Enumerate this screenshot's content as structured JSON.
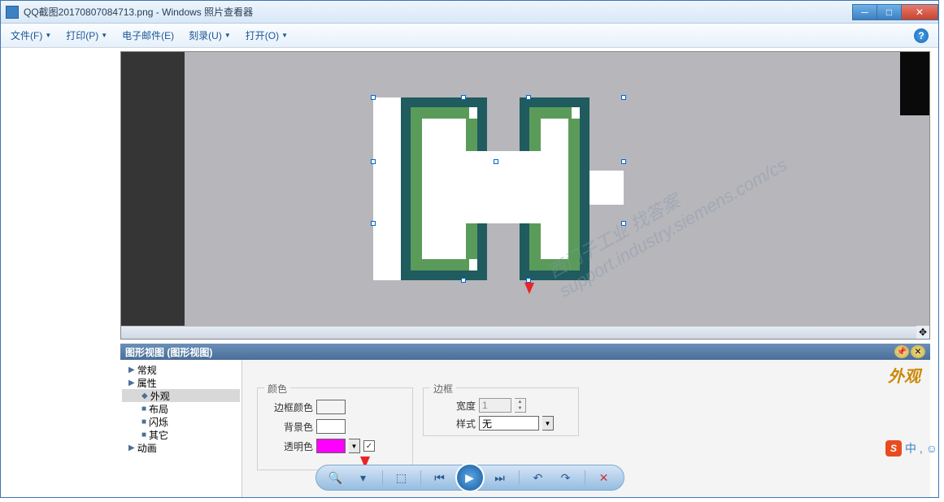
{
  "window": {
    "title": "QQ截图20170807084713.png - Windows 照片查看器"
  },
  "menu": {
    "file": "文件(F)",
    "print": "打印(P)",
    "email": "电子邮件(E)",
    "burn": "刻录(U)",
    "open": "打开(O)"
  },
  "panel": {
    "title": "图形视图 (图形视图)",
    "section_title": "外观"
  },
  "tree": {
    "general": "常规",
    "properties": "属性",
    "appearance": "外观",
    "layout": "布局",
    "blink": "闪烁",
    "other": "其它",
    "animation": "动画"
  },
  "form": {
    "color_group": "颜色",
    "border_group": "边框",
    "border_color": "边框颜色",
    "bg_color": "背景色",
    "transparent": "透明色",
    "width": "宽度",
    "style": "样式",
    "width_value": "1",
    "style_value": "无"
  },
  "colors": {
    "border": "#000000",
    "bg": "#ffffff",
    "transparent": "#ff00ff"
  },
  "ime": {
    "text": "中 , ☺"
  },
  "watermark": "西门子工业 找答案\nsupport.industry.siemens.com/cs"
}
